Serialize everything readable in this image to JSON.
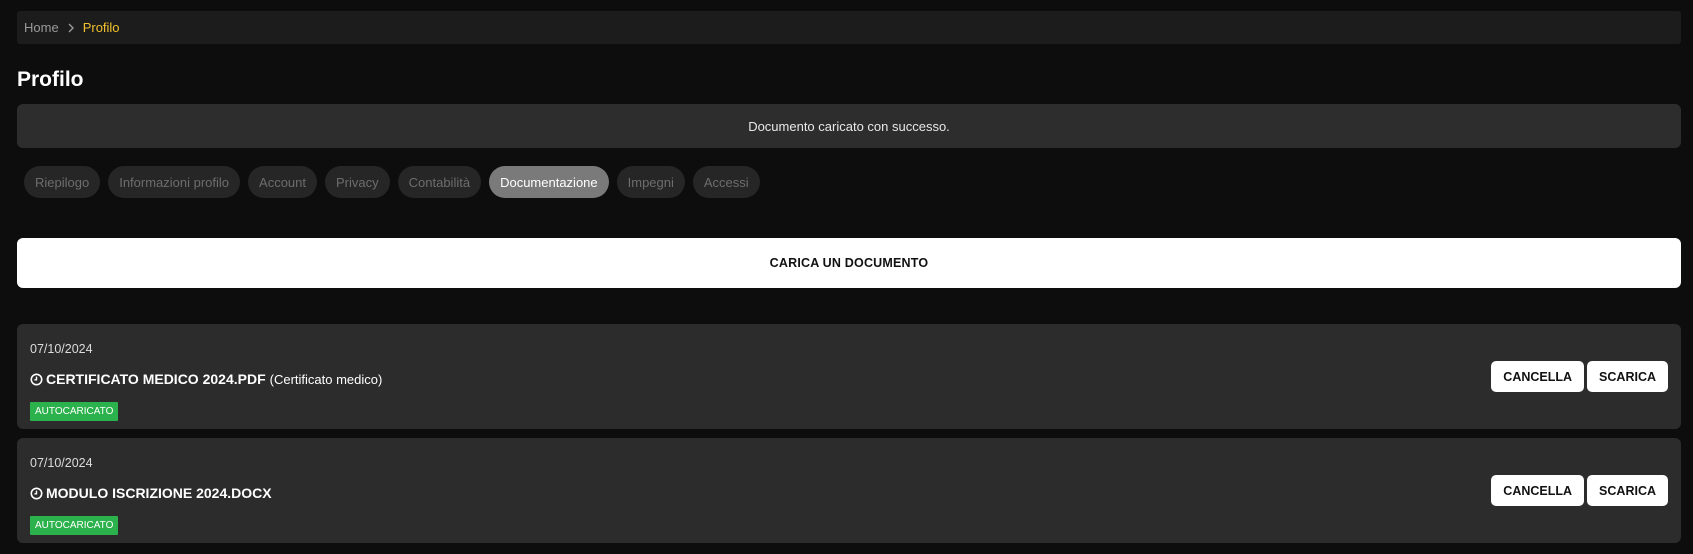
{
  "breadcrumb": {
    "home": "Home",
    "current": "Profilo"
  },
  "page_title": "Profilo",
  "alert": {
    "message": "Documento caricato con successo."
  },
  "tabs": [
    {
      "label": "Riepilogo",
      "active": false
    },
    {
      "label": "Informazioni profilo",
      "active": false
    },
    {
      "label": "Account",
      "active": false
    },
    {
      "label": "Privacy",
      "active": false
    },
    {
      "label": "Contabilità",
      "active": false
    },
    {
      "label": "Documentazione",
      "active": true
    },
    {
      "label": "Impegni",
      "active": false
    },
    {
      "label": "Accessi",
      "active": false
    }
  ],
  "upload_button": "CARICA UN DOCUMENTO",
  "documents": [
    {
      "date": "07/10/2024",
      "name": "CERTIFICATO MEDICO 2024.PDF",
      "type": "(Certificato medico)",
      "badge": "AUTOCARICATO",
      "delete_label": "CANCELLA",
      "download_label": "SCARICA"
    },
    {
      "date": "07/10/2024",
      "name": "MODULO ISCRIZIONE 2024.DOCX",
      "type": "",
      "badge": "AUTOCARICATO",
      "delete_label": "CANCELLA",
      "download_label": "SCARICA"
    }
  ],
  "colors": {
    "background": "#0d0d0d",
    "accent": "#f2c12e",
    "badge": "#2bb24c",
    "card": "#2c2c2c"
  },
  "icons": {
    "breadcrumb_separator": "chevron-right-icon",
    "document_status": "clock-icon"
  }
}
